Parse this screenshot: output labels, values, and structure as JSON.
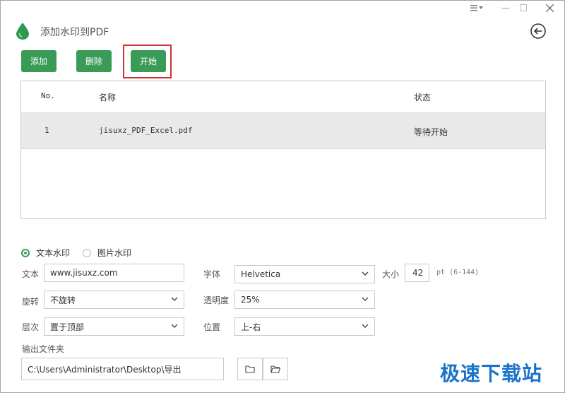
{
  "app": {
    "title": "添加水印到PDF"
  },
  "toolbar": {
    "add_label": "添加",
    "delete_label": "删除",
    "start_label": "开始"
  },
  "table": {
    "columns": [
      "No.",
      "名称",
      "状态"
    ],
    "rows": [
      {
        "no": "1",
        "name": "jisuxz_PDF_Excel.pdf",
        "status": "等待开始"
      }
    ]
  },
  "watermark_type": {
    "text_label": "文本水印",
    "image_label": "图片水印",
    "selected": "text"
  },
  "form": {
    "text_label": "文本",
    "text_value": "www.jisuxz.com",
    "font_label": "字体",
    "font_value": "Helvetica",
    "size_label": "大小",
    "size_value": "42",
    "size_hint": "pt (6-144)",
    "rotate_label": "旋转",
    "rotate_value": "不旋转",
    "opacity_label": "透明度",
    "opacity_value": "25%",
    "layer_label": "层次",
    "layer_value": "置于顶部",
    "position_label": "位置",
    "position_value": "上-右",
    "output_label": "输出文件夹",
    "output_path": "C:\\Users\\Administrator\\Desktop\\导出"
  },
  "branding": {
    "watermark_text": "极速下载站"
  },
  "colors": {
    "accent": "#3a9b57",
    "highlight": "#cc3333",
    "brand": "#1a73c9"
  },
  "icons": {
    "logo": "water-drop-icon",
    "back": "back-arrow-icon",
    "folder": "folder-icon",
    "open_folder": "open-folder-icon"
  }
}
